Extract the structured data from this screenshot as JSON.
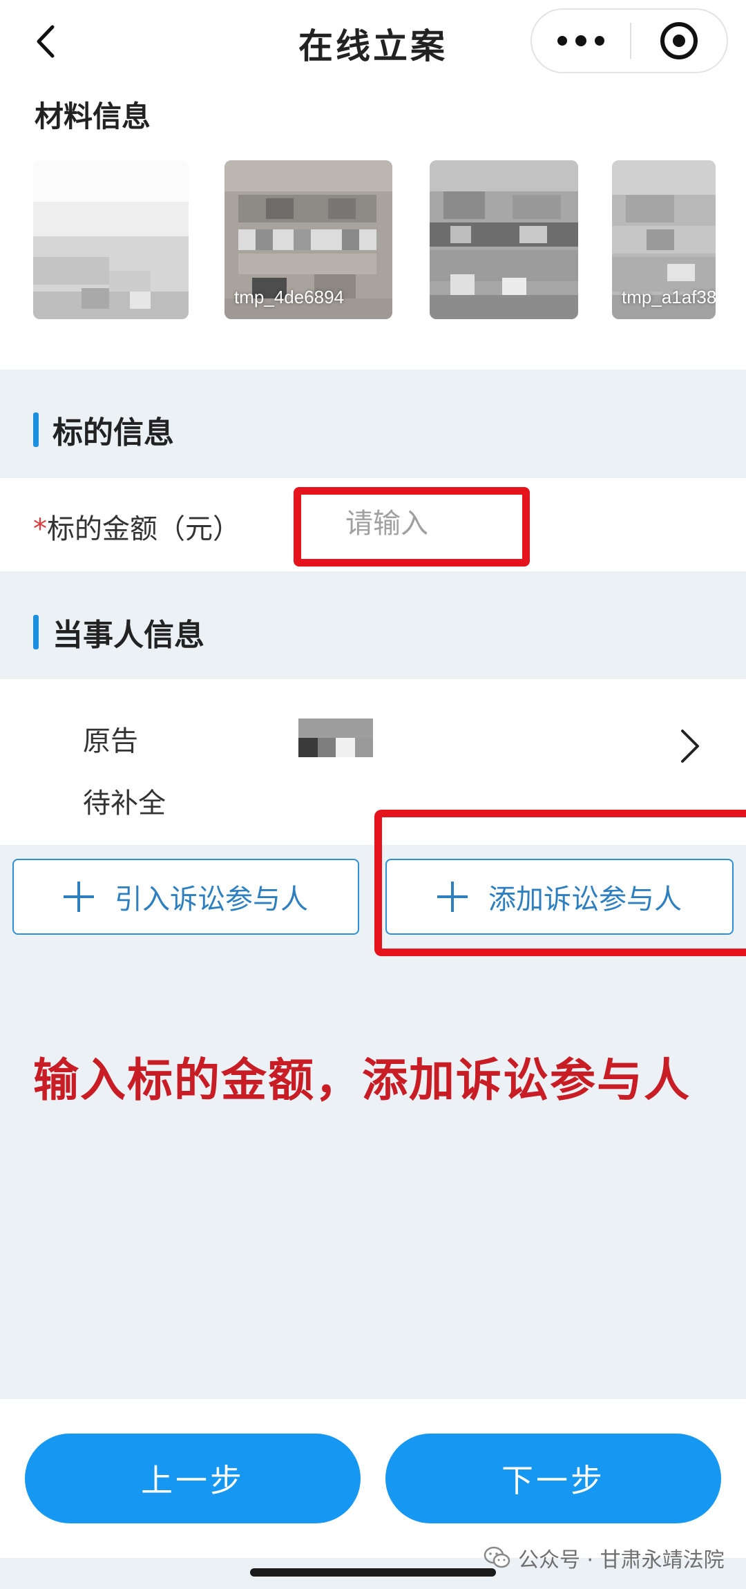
{
  "header": {
    "title": "在线立案"
  },
  "materials": {
    "title": "材料信息",
    "files": [
      {
        "name": ""
      },
      {
        "name": "tmp_4de6894"
      },
      {
        "name": ""
      },
      {
        "name": "tmp_a1af38"
      }
    ]
  },
  "subject": {
    "title": "标的信息",
    "amount_required_mark": "*",
    "amount_label": "标的金额（元）",
    "amount_placeholder": "请输入",
    "amount_value": ""
  },
  "parties": {
    "title": "当事人信息",
    "items": [
      {
        "role": "原告",
        "status": "待补全"
      }
    ],
    "import_button": "引入诉讼参与人",
    "add_button": "添加诉讼参与人"
  },
  "annotation": "输入标的金额，添加诉讼参与人",
  "footer": {
    "prev_button": "上一步",
    "next_button": "下一步"
  },
  "watermark": "公众号 · 甘肃永靖法院",
  "colors": {
    "primary_button": "#1597f2",
    "outline_accent": "#2d8fd5",
    "highlight": "#e5141c",
    "annotation_text": "#c81d25",
    "required_mark": "#e03a3a"
  }
}
